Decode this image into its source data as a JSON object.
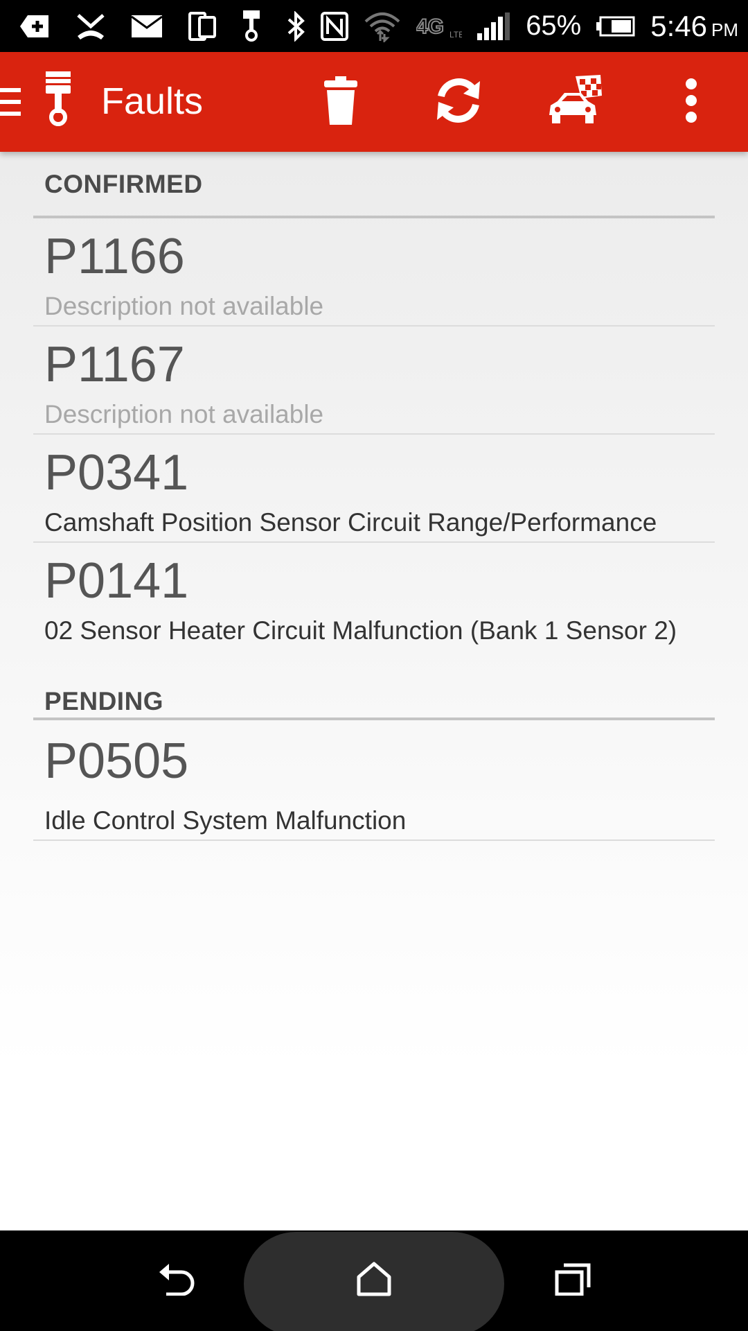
{
  "status_bar": {
    "battery": "65%",
    "time": "5:46",
    "time_suffix": "PM",
    "icons": [
      "add-notification-icon",
      "missed-call-icon",
      "mail-icon",
      "device-icon",
      "piston-notification-icon",
      "bluetooth-icon",
      "nfc-icon",
      "wifi-icon",
      "4g-lte-icon",
      "signal-icon",
      "battery-icon"
    ]
  },
  "app_bar": {
    "title": "Faults",
    "actions": [
      "trash-icon",
      "refresh-icon",
      "car-race-flag-icon",
      "overflow-menu-icon"
    ],
    "color": "#d9230f"
  },
  "sections": [
    {
      "title": "CONFIRMED",
      "faults": [
        {
          "code": "P1166",
          "description": "Description not available",
          "available": false
        },
        {
          "code": "P1167",
          "description": "Description not available",
          "available": false
        },
        {
          "code": "P0341",
          "description": "Camshaft Position Sensor Circuit Range/Performance",
          "available": true
        },
        {
          "code": "P0141",
          "description": "02 Sensor Heater Circuit Malfunction (Bank 1 Sensor 2)",
          "available": true
        }
      ]
    },
    {
      "title": "PENDING",
      "faults": [
        {
          "code": "P0505",
          "description": "Idle Control System Malfunction",
          "available": true
        }
      ]
    }
  ],
  "nav_bar": {
    "buttons": [
      "back-icon",
      "home-icon",
      "recents-icon"
    ]
  }
}
